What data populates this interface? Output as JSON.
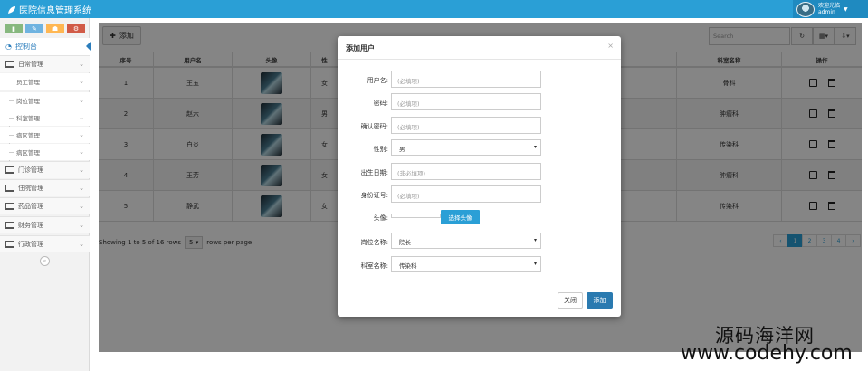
{
  "app": {
    "title": "医院信息管理系统"
  },
  "user": {
    "name": "欢迎光临",
    "role": "admin"
  },
  "sidebar": {
    "shortcuts": [
      {
        "icon": "bar-chart-icon",
        "color": "#87b87f"
      },
      {
        "icon": "pencil-icon",
        "color": "#6fb3e0"
      },
      {
        "icon": "users-icon",
        "color": "#ffb752"
      },
      {
        "icon": "cogs-icon",
        "color": "#d15b47"
      }
    ],
    "dashboard": "控制台",
    "items": [
      {
        "label": "日常管理"
      },
      {
        "label": "门诊管理"
      },
      {
        "label": "住院管理"
      },
      {
        "label": "药品管理"
      },
      {
        "label": "财务管理"
      },
      {
        "label": "行政管理"
      }
    ],
    "sub_items": [
      {
        "label": "员工管理"
      },
      {
        "label": "岗位管理"
      },
      {
        "label": "科室管理"
      },
      {
        "label": "病区管理"
      },
      {
        "label": "病区管理"
      }
    ]
  },
  "toolbar": {
    "add_label": "添加",
    "search_placeholder": "Search"
  },
  "table": {
    "headers": [
      "序号",
      "用户名",
      "头像",
      "性",
      "",
      "科室名称",
      "操作"
    ],
    "rows": [
      {
        "no": "1",
        "username": "王五",
        "gender": "女",
        "dept": "骨科"
      },
      {
        "no": "2",
        "username": "赵六",
        "gender": "男",
        "dept": "肿瘤科"
      },
      {
        "no": "3",
        "username": "白炎",
        "gender": "女",
        "dept": "传染科"
      },
      {
        "no": "4",
        "username": "王芳",
        "gender": "女",
        "dept": "肿瘤科"
      },
      {
        "no": "5",
        "username": "静武",
        "gender": "女",
        "dept": "传染科"
      }
    ]
  },
  "pager": {
    "info": "Showing 1 to 5 of 16 rows",
    "page_size": "5",
    "per_page": "rows per page",
    "pages": [
      "‹",
      "1",
      "2",
      "3",
      "4",
      "›"
    ],
    "active": "1"
  },
  "modal": {
    "title": "添加用户",
    "close_x": "×",
    "fields": {
      "username": {
        "label": "用户名:",
        "placeholder": "(必填项)"
      },
      "password": {
        "label": "密码:",
        "placeholder": "(必填项)"
      },
      "confirm": {
        "label": "确认密码:",
        "placeholder": "(必填项)"
      },
      "gender": {
        "label": "性别:",
        "value": "男"
      },
      "birth": {
        "label": "出生日期:",
        "placeholder": "(非必填项)"
      },
      "idcard": {
        "label": "身份证号:",
        "placeholder": "(必填项)"
      },
      "avatar": {
        "label": "头像:",
        "button": "选择头像"
      },
      "position": {
        "label": "岗位名称:",
        "value": "院长"
      },
      "dept": {
        "label": "科室名称:",
        "value": "传染科"
      }
    },
    "buttons": {
      "close": "关闭",
      "submit": "添加"
    }
  },
  "watermark": {
    "line1": "源码海洋网",
    "line2": "www.codehy.com"
  }
}
